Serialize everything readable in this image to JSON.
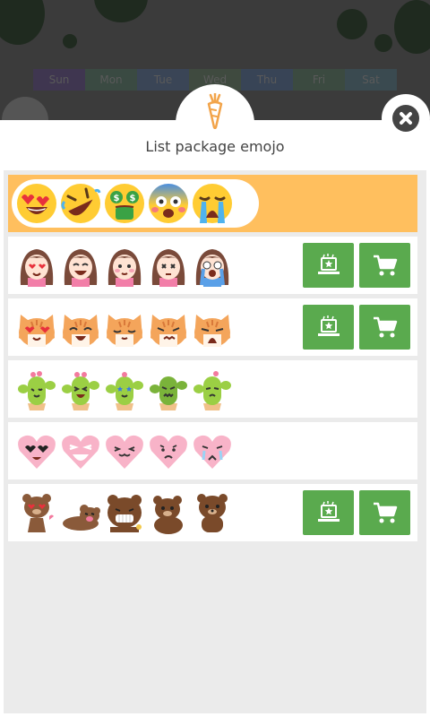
{
  "background": {
    "days": [
      "Sun",
      "Mon",
      "Tue",
      "Wed",
      "Thu",
      "Fri",
      "Sat"
    ]
  },
  "modal": {
    "title": "List package emojo",
    "header_icon": "carrot-icon",
    "close_icon": "close-icon"
  },
  "packages": [
    {
      "name": "classic-emoji",
      "selected": true,
      "icons": [
        "heart-eyes-face",
        "rolling-laughing-face",
        "money-mouth-face",
        "fearful-face",
        "crying-face"
      ],
      "has_actions": false
    },
    {
      "name": "girl-emoji",
      "selected": false,
      "icons": [
        "girl-heart-eyes",
        "girl-laughing",
        "girl-blushing",
        "girl-dizzy",
        "girl-crying"
      ],
      "has_actions": true
    },
    {
      "name": "cat-emoji",
      "selected": false,
      "icons": [
        "cat-heart-eyes",
        "cat-laughing",
        "cat-smiling",
        "cat-angry",
        "cat-crying"
      ],
      "has_actions": true
    },
    {
      "name": "cactus-emoji",
      "selected": false,
      "icons": [
        "cactus-wink",
        "cactus-grin",
        "cactus-star-eyes",
        "cactus-angry",
        "cactus-tired"
      ],
      "has_actions": false
    },
    {
      "name": "heart-emoji",
      "selected": false,
      "icons": [
        "heart-cool",
        "heart-laughing",
        "heart-cat-face",
        "heart-sad",
        "heart-crying"
      ],
      "has_actions": false
    },
    {
      "name": "bear-emoji",
      "selected": false,
      "icons": [
        "bear-love",
        "bear-lying",
        "bear-grin",
        "bear-sitting",
        "bear-standing"
      ],
      "has_actions": true
    }
  ],
  "actions": {
    "preview_icon": "laptop-star-icon",
    "buy_icon": "cart-icon"
  },
  "colors": {
    "selected_row": "#ffbf5e",
    "action_button": "#5aaa4e",
    "list_bg": "#ebebeb"
  }
}
